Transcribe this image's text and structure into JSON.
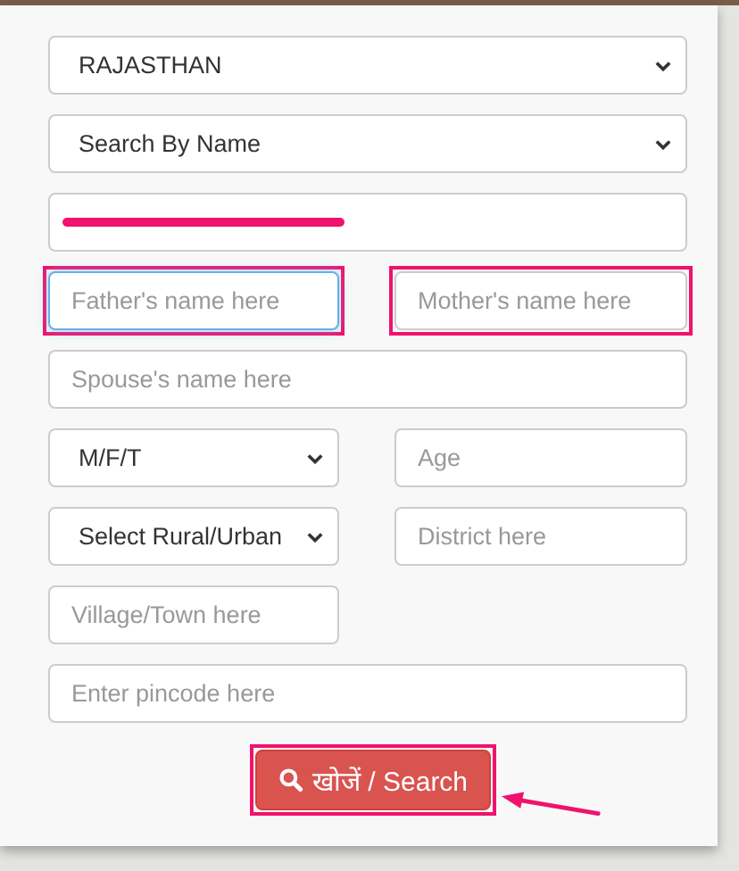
{
  "form": {
    "fields": [
      {
        "kind": "select",
        "wide": true,
        "value": "RAJASTHAN",
        "highlighted": false,
        "focused": false
      },
      {
        "kind": "select",
        "wide": true,
        "value": "Search By Name",
        "highlighted": false,
        "focused": false
      },
      {
        "kind": "input",
        "wide": true,
        "redacted": true,
        "highlighted": false,
        "focused": false
      },
      {
        "kind": "input",
        "wide": false,
        "placeholder": "Father's name here",
        "highlighted": true,
        "focused": true
      },
      {
        "kind": "input",
        "wide": false,
        "placeholder": "Mother's name here",
        "highlighted": true,
        "focused": false
      },
      {
        "kind": "input",
        "wide": true,
        "placeholder": "Spouse's name here",
        "highlighted": false,
        "focused": false
      },
      {
        "kind": "select",
        "wide": false,
        "value": "M/F/T",
        "highlighted": false,
        "focused": false
      },
      {
        "kind": "input",
        "wide": false,
        "placeholder": "Age",
        "highlighted": false,
        "focused": false
      },
      {
        "kind": "select",
        "wide": false,
        "value": "Select Rural/Urban",
        "highlighted": false,
        "focused": false
      },
      {
        "kind": "input",
        "wide": false,
        "placeholder": "District here",
        "highlighted": false,
        "focused": false
      },
      {
        "kind": "input",
        "wide": false,
        "placeholder": "Village/Town here",
        "highlighted": false,
        "focused": false
      },
      {
        "kind": "input",
        "wide": true,
        "placeholder": "Enter pincode here",
        "highlighted": false,
        "focused": false
      }
    ],
    "search_button": {
      "label": "खोजें / Search",
      "highlighted": true
    }
  }
}
